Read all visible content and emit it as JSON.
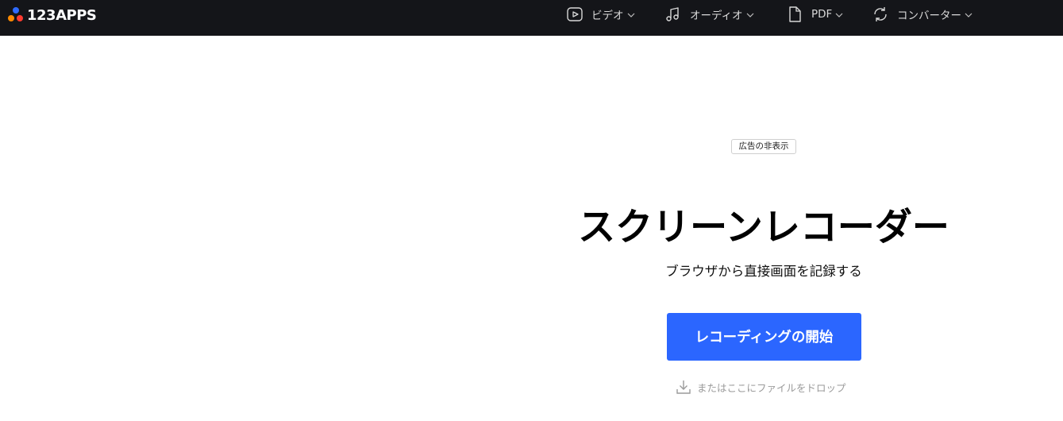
{
  "header": {
    "logo_text": "123APPS",
    "nav": [
      {
        "label": "ビデオ",
        "icon": "video-play-icon"
      },
      {
        "label": "オーディオ",
        "icon": "music-note-icon"
      },
      {
        "label": "PDF",
        "icon": "document-icon"
      },
      {
        "label": "コンバーター",
        "icon": "convert-arrows-icon"
      }
    ]
  },
  "main": {
    "ad_hide_label": "広告の非表示",
    "title": "スクリーンレコーダー",
    "subtitle": "ブラウザから直接画面を記録する",
    "start_button": "レコーディングの開始",
    "drop_hint": "またはここにファイルをドロップ"
  },
  "colors": {
    "header_bg": "#141519",
    "accent": "#2b66ff",
    "logo_dot_blue": "#2f6bff",
    "logo_dot_orange": "#ff8a00",
    "logo_dot_red": "#ff3b30"
  }
}
